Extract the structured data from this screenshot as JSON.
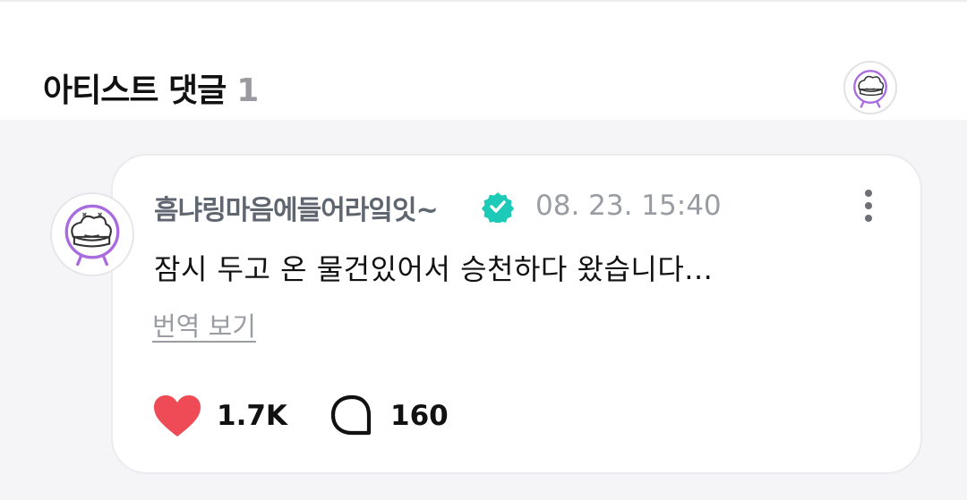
{
  "section": {
    "title": "아티스트 댓글",
    "count": "1"
  },
  "comment": {
    "author": "흠냐링마음에들어라잌잇~",
    "timestamp": "08. 23. 15:40",
    "body": "잠시 두고 온 물건있어서 승천하다 왔습니다...",
    "translate_label": "번역 보기",
    "likes": "1.7K",
    "replies": "160"
  },
  "icons": {
    "verified": "verified-badge-icon",
    "like": "heart-icon",
    "reply": "speech-bubble-icon",
    "more": "more-vertical-icon"
  },
  "colors": {
    "like": "#ef4b57",
    "verified": "#1dc9b7",
    "avatar_outline": "#a86be0"
  }
}
